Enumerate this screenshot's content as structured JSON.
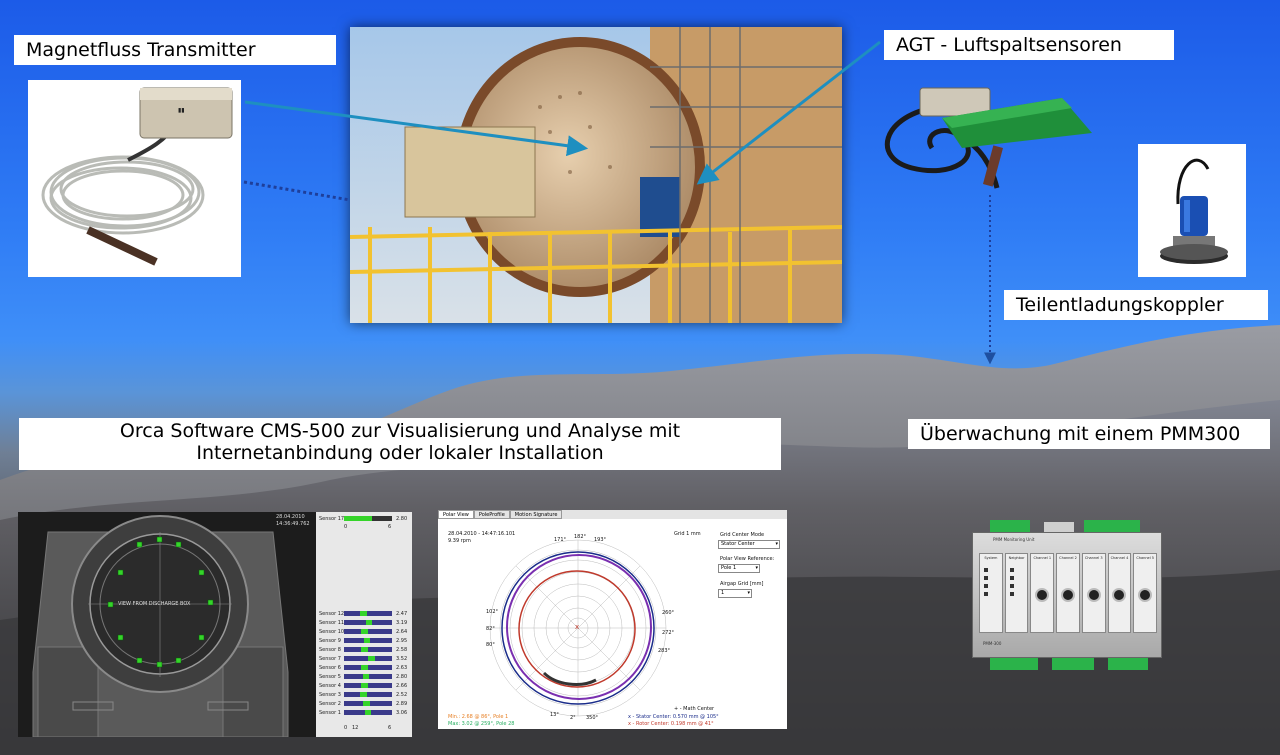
{
  "labels": {
    "magnetflux": "Magnetfluss Transmitter",
    "agt": "AGT - Luftspaltsensoren",
    "coupler": "Teilentladungskoppler",
    "pmm": "Überwachung mit einem PMM300",
    "software_line1": "Orca Software CMS-500 zur Visualisierung und Analyse mit",
    "software_line2": "Internetanbindung oder lokaler Installation"
  },
  "rotor_view": {
    "view_text": "VIEW FROM DISCHARGE BOX",
    "timestamp_line1": "28.04.2010",
    "timestamp_line2": "14:36:49.762",
    "top_sensor": {
      "name": "Sensor 17",
      "value": "2.80",
      "min": "0",
      "max": "6"
    },
    "sensors": [
      {
        "name": "Sensor 12",
        "value": "2.47"
      },
      {
        "name": "Sensor 11",
        "value": "3.19"
      },
      {
        "name": "Sensor 10",
        "value": "2.64"
      },
      {
        "name": "Sensor 9",
        "value": "2.95"
      },
      {
        "name": "Sensor 8",
        "value": "2.58"
      },
      {
        "name": "Sensor 7",
        "value": "3.52"
      },
      {
        "name": "Sensor 6",
        "value": "2.63"
      },
      {
        "name": "Sensor 5",
        "value": "2.80"
      },
      {
        "name": "Sensor 4",
        "value": "2.66"
      },
      {
        "name": "Sensor 3",
        "value": "2.52"
      },
      {
        "name": "Sensor 2",
        "value": "2.89"
      },
      {
        "name": "Sensor 1",
        "value": "3.06"
      }
    ],
    "axis_min": "0",
    "axis_mid": "12",
    "axis_max": "6"
  },
  "polar_view": {
    "tabs": [
      "Polar View",
      "PoleProfile",
      "Motion Signature"
    ],
    "date": "28.04.2010 - 14:47:16.101",
    "rpm": "9.39 rpm",
    "grid": "Grid 1 mm",
    "grid_center_mode_label": "Grid Center Mode",
    "grid_center_mode_value": "Stator Center",
    "polar_ref_label": "Polar View Reference:",
    "polar_ref_value": "Pole 1",
    "airgap_label": "Airgap Grid [mm]",
    "airgap_value": "1",
    "angles": [
      "171°",
      "182°",
      "193°",
      "102°",
      "82°",
      "80°",
      "260°",
      "272°",
      "283°",
      "13°",
      "2°",
      "350°"
    ],
    "min_text": "Min.: 2.68 @ 86°, Pole 1",
    "max_text": "Max: 3.02 @ 259°, Pole 28",
    "math_center": "+ - Math Center",
    "stator_center": "x - Stator Center: 0.570 mm @ 105°",
    "rotor_center": "x - Rotor Center: 0.198 mm @ 41°"
  },
  "pmm_device": {
    "title": "PMM Monitoring Unit",
    "columns": [
      "System",
      "Neighbor",
      "Channel 1",
      "Channel 2",
      "Channel 3",
      "Channel 4",
      "Channel 5"
    ],
    "footer": "PMM-300"
  },
  "colors": {
    "sky": "#2f7cf5",
    "arrow": "#1e8fc0",
    "sensor_green": "#35d42a"
  }
}
